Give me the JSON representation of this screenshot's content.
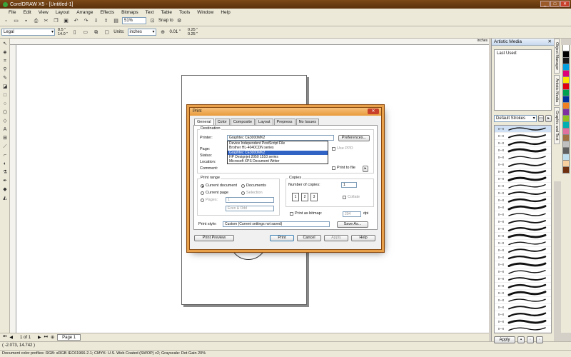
{
  "window": {
    "title": "CorelDRAW X5 - [Untitled-1]"
  },
  "menu": [
    "File",
    "Edit",
    "View",
    "Layout",
    "Arrange",
    "Effects",
    "Bitmaps",
    "Text",
    "Table",
    "Tools",
    "Window",
    "Help"
  ],
  "toolbar": {
    "zoom": "51%",
    "snap_label": "Snap to"
  },
  "property_bar": {
    "paper_size": "Legal",
    "width": "8.5 \"",
    "height": "14.0 \"",
    "units_label": "Units:",
    "units": "inches",
    "nudge": "0.01 \"",
    "dup_x": "0.25 \"",
    "dup_y": "0.25 \""
  },
  "ruler": {
    "units": "inches"
  },
  "pages": {
    "counter": "1 of 1",
    "tab": "Page 1"
  },
  "status": {
    "coords": "( -2.073, 14.742 )",
    "color_profiles": "Document color profiles: RGB: sRGB IEC61966-2.1; CMYK: U.S. Web Coated (SWOP) v2; Grayscale: Dot Gain 20%"
  },
  "docker": {
    "title": "Artistic Media",
    "last_used": "Last Used:",
    "strokes_select": "Default Strokes",
    "apply": "Apply",
    "tabs": [
      "Object Manager",
      "Artistic Media",
      "Graphic and Text"
    ]
  },
  "print_dialog": {
    "title": "Print",
    "tabs": [
      "General",
      "Color",
      "Composite",
      "Layout",
      "Prepress",
      "No Issues"
    ],
    "destination_label": "Destination",
    "printer_label": "Printer:",
    "printer_value": "Graphtec CE3000MK2",
    "preferences": "Preferences...",
    "printer_options": [
      "Device Independent PostScript File",
      "Brother HL-4040CDN series",
      "Graphtec CE3000MK2",
      "HP Designjet 2050 1510 series",
      "Microsoft XPS Document Writer"
    ],
    "selected_option": "Graphtec CE3000MK2",
    "page_label": "Page:",
    "status_label": "Status:",
    "location_label": "Location:",
    "comment_label": "Comment:",
    "use_ppd": "Use PPD",
    "print_to_file": "Print to file",
    "print_range_label": "Print range",
    "current_document": "Current document",
    "documents": "Documents",
    "current_page": "Current page",
    "selection": "Selection",
    "pages_label": "Pages:",
    "pages_value": "1",
    "even_odd": "Even & Odd",
    "copies_label": "Copies",
    "number_of_copies": "Number of copies:",
    "copies_value": "1",
    "collate": "Collate",
    "print_as_bitmap": "Print as bitmap:",
    "dpi_value": "204",
    "dpi_unit": "dpi",
    "print_style_label": "Print style:",
    "print_style_value": "Custom (Current settings not saved)",
    "save_as": "Save As...",
    "print_preview": "Print Preview",
    "print": "Print",
    "cancel": "Cancel",
    "apply": "Apply",
    "help": "Help"
  },
  "palette_colors": [
    "#ffffff",
    "#000000",
    "#1a1a1a",
    "#00a0e0",
    "#e0007a",
    "#ffe600",
    "#e00010",
    "#00a050",
    "#0030a0",
    "#f08020",
    "#8030a0",
    "#90c020",
    "#00b0b0",
    "#e070a0",
    "#a07040",
    "#c0c0c0",
    "#606060",
    "#c0e0f0",
    "#f8d0a0",
    "#703010"
  ]
}
